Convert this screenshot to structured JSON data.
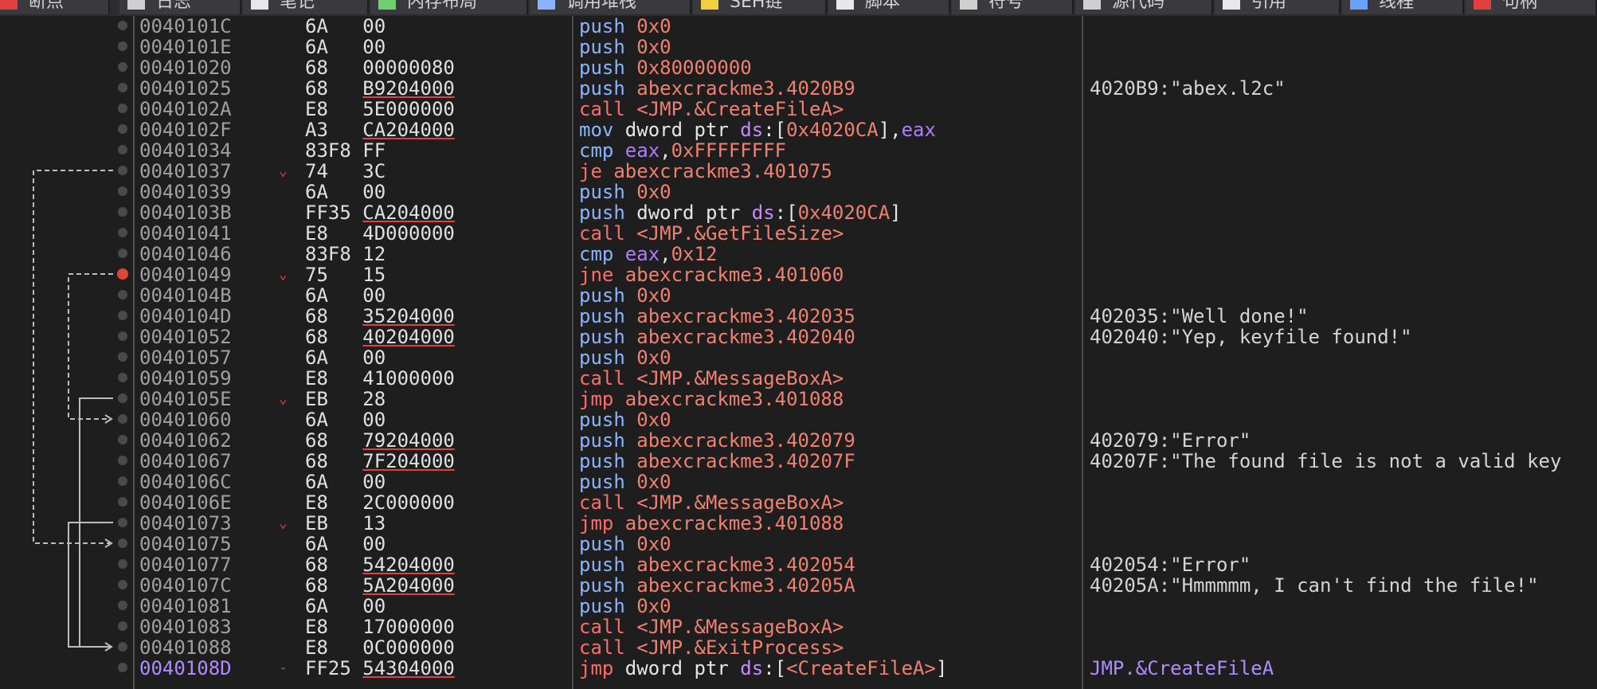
{
  "tabs": [
    "断点",
    "日志",
    "笔记",
    "内存布局",
    "调用堆栈",
    "SEH链",
    "脚本",
    "符号",
    "源代码",
    "引用",
    "线程",
    "句柄"
  ],
  "rows": [
    {
      "addr": "0040101C",
      "bytes_a": "6A",
      "bytes_b": "00",
      "ul": false,
      "dis": [
        [
          "k-blue",
          "push "
        ],
        [
          "k-sal",
          "0x0"
        ]
      ],
      "comment": ""
    },
    {
      "addr": "0040101E",
      "bytes_a": "6A",
      "bytes_b": "00",
      "ul": false,
      "dis": [
        [
          "k-blue",
          "push "
        ],
        [
          "k-sal",
          "0x0"
        ]
      ],
      "comment": ""
    },
    {
      "addr": "00401020",
      "bytes_a": "68",
      "bytes_b": "00000080",
      "ul": false,
      "dis": [
        [
          "k-blue",
          "push "
        ],
        [
          "k-sal",
          "0x80000000"
        ]
      ],
      "comment": ""
    },
    {
      "addr": "00401025",
      "bytes_a": "68",
      "bytes_b": "B9204000",
      "ul": true,
      "dis": [
        [
          "k-blue",
          "push "
        ],
        [
          "k-sal",
          "abexcrackme3.4020B9"
        ]
      ],
      "comment": "4020B9:\"abex.l2c\""
    },
    {
      "addr": "0040102A",
      "bytes_a": "E8",
      "bytes_b": "5E000000",
      "ul": false,
      "dis": [
        [
          "k-red",
          "call "
        ],
        [
          "k-sal",
          "<JMP.&CreateFileA>"
        ]
      ],
      "comment": ""
    },
    {
      "addr": "0040102F",
      "bytes_a": "A3",
      "bytes_b": "CA204000",
      "ul": true,
      "dis": [
        [
          "k-blue",
          "mov "
        ],
        [
          "k-wht",
          "dword ptr "
        ],
        [
          "k-pur",
          "ds"
        ],
        [
          "k-wht",
          ":["
        ],
        [
          "k-sal",
          "0x4020CA"
        ],
        [
          "k-wht",
          "],"
        ],
        [
          "k-reg",
          "eax"
        ]
      ],
      "comment": ""
    },
    {
      "addr": "00401034",
      "bytes_a": "83F8",
      "bytes_b": "FF",
      "ul": false,
      "dis": [
        [
          "k-blue",
          "cmp "
        ],
        [
          "k-reg",
          "eax"
        ],
        [
          "k-wht",
          ","
        ],
        [
          "k-sal",
          "0xFFFFFFFF"
        ]
      ],
      "comment": ""
    },
    {
      "addr": "00401037",
      "arrow": "⌄",
      "bytes_a": "74",
      "bytes_b": "3C",
      "ul": false,
      "dis": [
        [
          "k-red",
          "je "
        ],
        [
          "k-sal",
          "abexcrackme3.401075"
        ]
      ],
      "comment": ""
    },
    {
      "addr": "00401039",
      "bytes_a": "6A",
      "bytes_b": "00",
      "ul": false,
      "dis": [
        [
          "k-blue",
          "push "
        ],
        [
          "k-sal",
          "0x0"
        ]
      ],
      "comment": ""
    },
    {
      "addr": "0040103B",
      "bytes_a": "FF35",
      "bytes_b": "CA204000",
      "ul": true,
      "dis": [
        [
          "k-blue",
          "push "
        ],
        [
          "k-wht",
          "dword ptr "
        ],
        [
          "k-pur",
          "ds"
        ],
        [
          "k-wht",
          ":["
        ],
        [
          "k-sal",
          "0x4020CA"
        ],
        [
          "k-wht",
          "]"
        ]
      ],
      "comment": ""
    },
    {
      "addr": "00401041",
      "bytes_a": "E8",
      "bytes_b": "4D000000",
      "ul": false,
      "dis": [
        [
          "k-red",
          "call "
        ],
        [
          "k-sal",
          "<JMP.&GetFileSize>"
        ]
      ],
      "comment": ""
    },
    {
      "addr": "00401046",
      "bytes_a": "83F8",
      "bytes_b": "12",
      "ul": false,
      "dis": [
        [
          "k-blue",
          "cmp "
        ],
        [
          "k-reg",
          "eax"
        ],
        [
          "k-wht",
          ","
        ],
        [
          "k-sal",
          "0x12"
        ]
      ],
      "comment": ""
    },
    {
      "addr": "00401049",
      "arrow": "⌄",
      "bytes_a": "75",
      "bytes_b": "15",
      "ul": false,
      "dis": [
        [
          "k-red",
          "jne "
        ],
        [
          "k-sal",
          "abexcrackme3.401060"
        ]
      ],
      "comment": ""
    },
    {
      "addr": "0040104B",
      "bytes_a": "6A",
      "bytes_b": "00",
      "ul": false,
      "dis": [
        [
          "k-blue",
          "push "
        ],
        [
          "k-sal",
          "0x0"
        ]
      ],
      "comment": ""
    },
    {
      "addr": "0040104D",
      "bytes_a": "68",
      "bytes_b": "35204000",
      "ul": true,
      "dis": [
        [
          "k-blue",
          "push "
        ],
        [
          "k-sal",
          "abexcrackme3.402035"
        ]
      ],
      "comment": "402035:\"Well done!\""
    },
    {
      "addr": "00401052",
      "bytes_a": "68",
      "bytes_b": "40204000",
      "ul": true,
      "dis": [
        [
          "k-blue",
          "push "
        ],
        [
          "k-sal",
          "abexcrackme3.402040"
        ]
      ],
      "comment": "402040:\"Yep, keyfile found!\""
    },
    {
      "addr": "00401057",
      "bytes_a": "6A",
      "bytes_b": "00",
      "ul": false,
      "dis": [
        [
          "k-blue",
          "push "
        ],
        [
          "k-sal",
          "0x0"
        ]
      ],
      "comment": ""
    },
    {
      "addr": "00401059",
      "bytes_a": "E8",
      "bytes_b": "41000000",
      "ul": false,
      "dis": [
        [
          "k-red",
          "call "
        ],
        [
          "k-sal",
          "<JMP.&MessageBoxA>"
        ]
      ],
      "comment": ""
    },
    {
      "addr": "0040105E",
      "arrow": "⌄",
      "bytes_a": "EB",
      "bytes_b": "28",
      "ul": false,
      "dis": [
        [
          "k-red",
          "jmp "
        ],
        [
          "k-sal",
          "abexcrackme3.401088"
        ]
      ],
      "comment": ""
    },
    {
      "addr": "00401060",
      "bytes_a": "6A",
      "bytes_b": "00",
      "ul": false,
      "dis": [
        [
          "k-blue",
          "push "
        ],
        [
          "k-sal",
          "0x0"
        ]
      ],
      "comment": ""
    },
    {
      "addr": "00401062",
      "bytes_a": "68",
      "bytes_b": "79204000",
      "ul": true,
      "dis": [
        [
          "k-blue",
          "push "
        ],
        [
          "k-sal",
          "abexcrackme3.402079"
        ]
      ],
      "comment": "402079:\"Error\""
    },
    {
      "addr": "00401067",
      "bytes_a": "68",
      "bytes_b": "7F204000",
      "ul": true,
      "dis": [
        [
          "k-blue",
          "push "
        ],
        [
          "k-sal",
          "abexcrackme3.40207F"
        ]
      ],
      "comment": "40207F:\"The found file is not a valid key"
    },
    {
      "addr": "0040106C",
      "bytes_a": "6A",
      "bytes_b": "00",
      "ul": false,
      "dis": [
        [
          "k-blue",
          "push "
        ],
        [
          "k-sal",
          "0x0"
        ]
      ],
      "comment": ""
    },
    {
      "addr": "0040106E",
      "bytes_a": "E8",
      "bytes_b": "2C000000",
      "ul": false,
      "dis": [
        [
          "k-red",
          "call "
        ],
        [
          "k-sal",
          "<JMP.&MessageBoxA>"
        ]
      ],
      "comment": ""
    },
    {
      "addr": "00401073",
      "arrow": "⌄",
      "bytes_a": "EB",
      "bytes_b": "13",
      "ul": false,
      "dis": [
        [
          "k-red",
          "jmp "
        ],
        [
          "k-sal",
          "abexcrackme3.401088"
        ]
      ],
      "comment": ""
    },
    {
      "addr": "00401075",
      "bytes_a": "6A",
      "bytes_b": "00",
      "ul": false,
      "dis": [
        [
          "k-blue",
          "push "
        ],
        [
          "k-sal",
          "0x0"
        ]
      ],
      "comment": ""
    },
    {
      "addr": "00401077",
      "bytes_a": "68",
      "bytes_b": "54204000",
      "ul": true,
      "dis": [
        [
          "k-blue",
          "push "
        ],
        [
          "k-sal",
          "abexcrackme3.402054"
        ]
      ],
      "comment": "402054:\"Error\""
    },
    {
      "addr": "0040107C",
      "bytes_a": "68",
      "bytes_b": "5A204000",
      "ul": true,
      "dis": [
        [
          "k-blue",
          "push "
        ],
        [
          "k-sal",
          "abexcrackme3.40205A"
        ]
      ],
      "comment": "40205A:\"Hmmmmm, I can't find the file!\""
    },
    {
      "addr": "00401081",
      "bytes_a": "6A",
      "bytes_b": "00",
      "ul": false,
      "dis": [
        [
          "k-blue",
          "push "
        ],
        [
          "k-sal",
          "0x0"
        ]
      ],
      "comment": ""
    },
    {
      "addr": "00401083",
      "bytes_a": "E8",
      "bytes_b": "17000000",
      "ul": false,
      "dis": [
        [
          "k-red",
          "call "
        ],
        [
          "k-sal",
          "<JMP.&MessageBoxA>"
        ]
      ],
      "comment": ""
    },
    {
      "addr": "00401088",
      "bytes_a": "E8",
      "bytes_b": "0C000000",
      "ul": false,
      "dis": [
        [
          "k-red",
          "call "
        ],
        [
          "k-sal",
          "<JMP.&ExitProcess>"
        ]
      ],
      "comment": ""
    },
    {
      "addr": "0040108D",
      "highlight": true,
      "arrow": "-",
      "bytes_a": "FF25",
      "bytes_b": "54304000",
      "ul": true,
      "dis": [
        [
          "k-red",
          "jmp "
        ],
        [
          "k-wht",
          "dword ptr "
        ],
        [
          "k-pur",
          "ds"
        ],
        [
          "k-wht",
          ":["
        ],
        [
          "k-sal",
          "<CreateFileA>"
        ],
        [
          "k-wht",
          "]"
        ]
      ],
      "comment": "JMP.&CreateFileA",
      "comment_color": "#b08bff"
    }
  ],
  "breakpoint_row": 12,
  "colors": {
    "background": "#1e1e1e",
    "address": "#a0a0a0",
    "mnemonic_push": "#8ab4ff",
    "mnemonic_call_jmp": "#ff6b6b",
    "operand": "#f08070",
    "breakpoint": "#e0453a"
  }
}
